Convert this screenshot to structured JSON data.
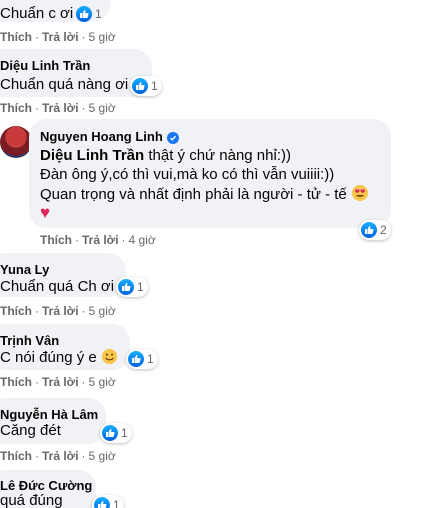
{
  "comments": [
    {
      "author": "",
      "text": "Chuẩn c ơi",
      "like_label": "Thích",
      "reply_label": "Trả lời",
      "time": "5 giờ",
      "reactions": "1"
    },
    {
      "author": "Diệu Linh Trần",
      "text": "Chuẩn quá nàng ơi",
      "like_label": "Thích",
      "reply_label": "Trả lời",
      "time": "5 giờ",
      "reactions": "1"
    },
    {
      "author": "Nguyen Hoang Linh",
      "verified": true,
      "mention": "Diệu Linh Trần",
      "lines": [
        " thật ý chứ nàng nhỉ:))",
        "Đàn ông ý,có thì vui,mà ko có thì vẫn vuiiii:))",
        "Quan trọng và nhất định phải là người - tử - tế"
      ],
      "like_label": "Thích",
      "reply_label": "Trả lời",
      "time": "4 giờ",
      "reactions": "2"
    },
    {
      "author": "Yuna Ly",
      "text": "Chuẩn quá Ch ơi",
      "like_label": "Thích",
      "reply_label": "Trả lời",
      "time": "5 giờ",
      "reactions": "1"
    },
    {
      "author": "Trịnh Vân",
      "text": "C nói đúng ý e",
      "like_label": "Thích",
      "reply_label": "Trả lời",
      "time": "5 giờ",
      "reactions": "1"
    },
    {
      "author": "Nguyễn Hà Lâm",
      "text": "Căng đét",
      "like_label": "Thích",
      "reply_label": "Trả lời",
      "time": "5 giờ",
      "reactions": "1"
    },
    {
      "author": "Lê Đức Cường",
      "text": "quá đúng",
      "reactions": "1"
    }
  ],
  "colors": {
    "bubble": "#f0f2f5",
    "like_blue": "#1877f2",
    "meta_gray": "#65676b"
  }
}
